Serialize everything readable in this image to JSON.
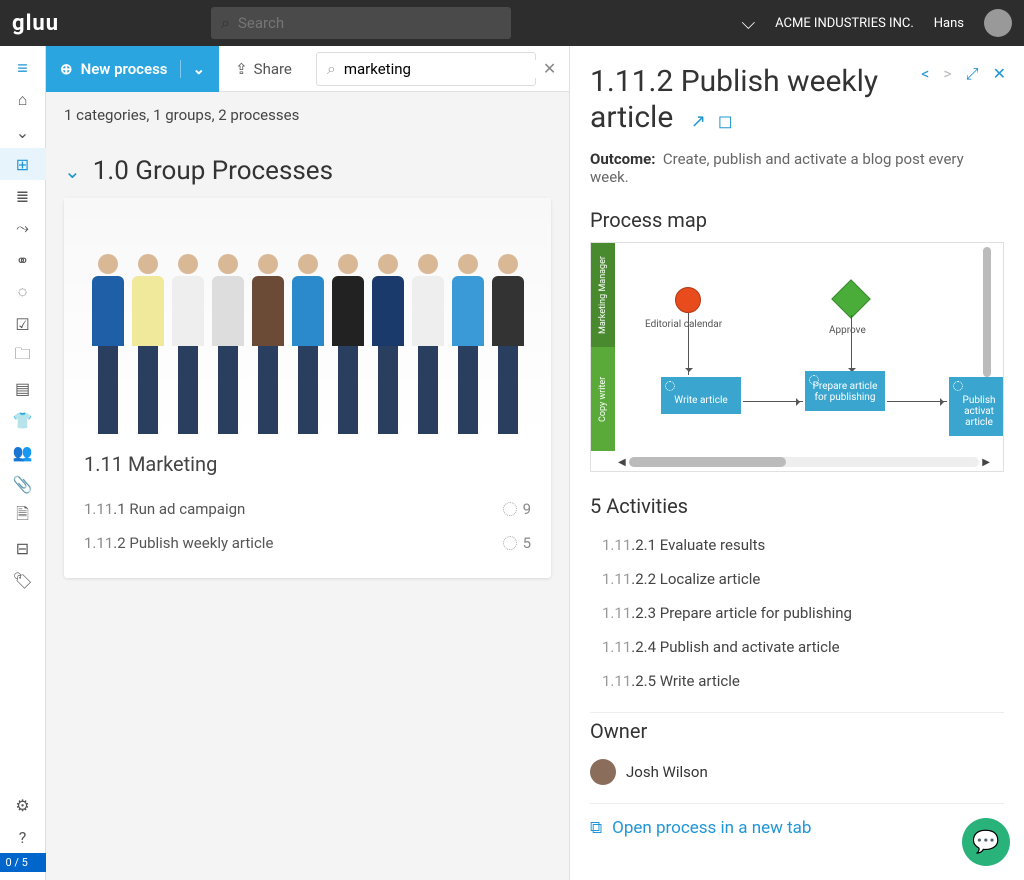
{
  "brand": "gluu",
  "search_placeholder": "Search",
  "company": "ACME INDUSTRIES INC.",
  "user": "Hans",
  "counter": "0 / 5",
  "toolbar": {
    "new_process": "New process",
    "share": "Share",
    "filter_value": "marketing"
  },
  "meta": "1 categories, 1 groups, 2 processes",
  "group": {
    "title": "1.0 Group Processes",
    "card_title": "1.11 Marketing",
    "rows": [
      {
        "num": "1.11",
        "rest": ".1 Run ad campaign",
        "count": "9"
      },
      {
        "num": "1.11",
        "rest": ".2 Publish weekly article",
        "count": "5"
      }
    ]
  },
  "detail": {
    "title": "1.11.2 Publish weekly article",
    "outcome_label": "Outcome:",
    "outcome_text": "Create, publish and activate a blog post every week.",
    "map_heading": "Process map",
    "lanes": [
      "Marketing Manager",
      "Copy writer"
    ],
    "map_labels": {
      "e": "Editorial calendar",
      "a": "Approve"
    },
    "tasks": [
      "Write article",
      "Prepare article for publishing",
      "Publish activat article"
    ],
    "activities_heading": "5 Activities",
    "activities": [
      {
        "pre": "1.11",
        "rest": ".2.1 Evaluate results"
      },
      {
        "pre": "1.11",
        "rest": ".2.2 Localize article"
      },
      {
        "pre": "1.11",
        "rest": ".2.3 Prepare article for publishing"
      },
      {
        "pre": "1.11",
        "rest": ".2.4 Publish and activate article"
      },
      {
        "pre": "1.11",
        "rest": ".2.5 Write article"
      }
    ],
    "owner_heading": "Owner",
    "owner": "Josh Wilson",
    "open_link": "Open process in a new tab"
  }
}
